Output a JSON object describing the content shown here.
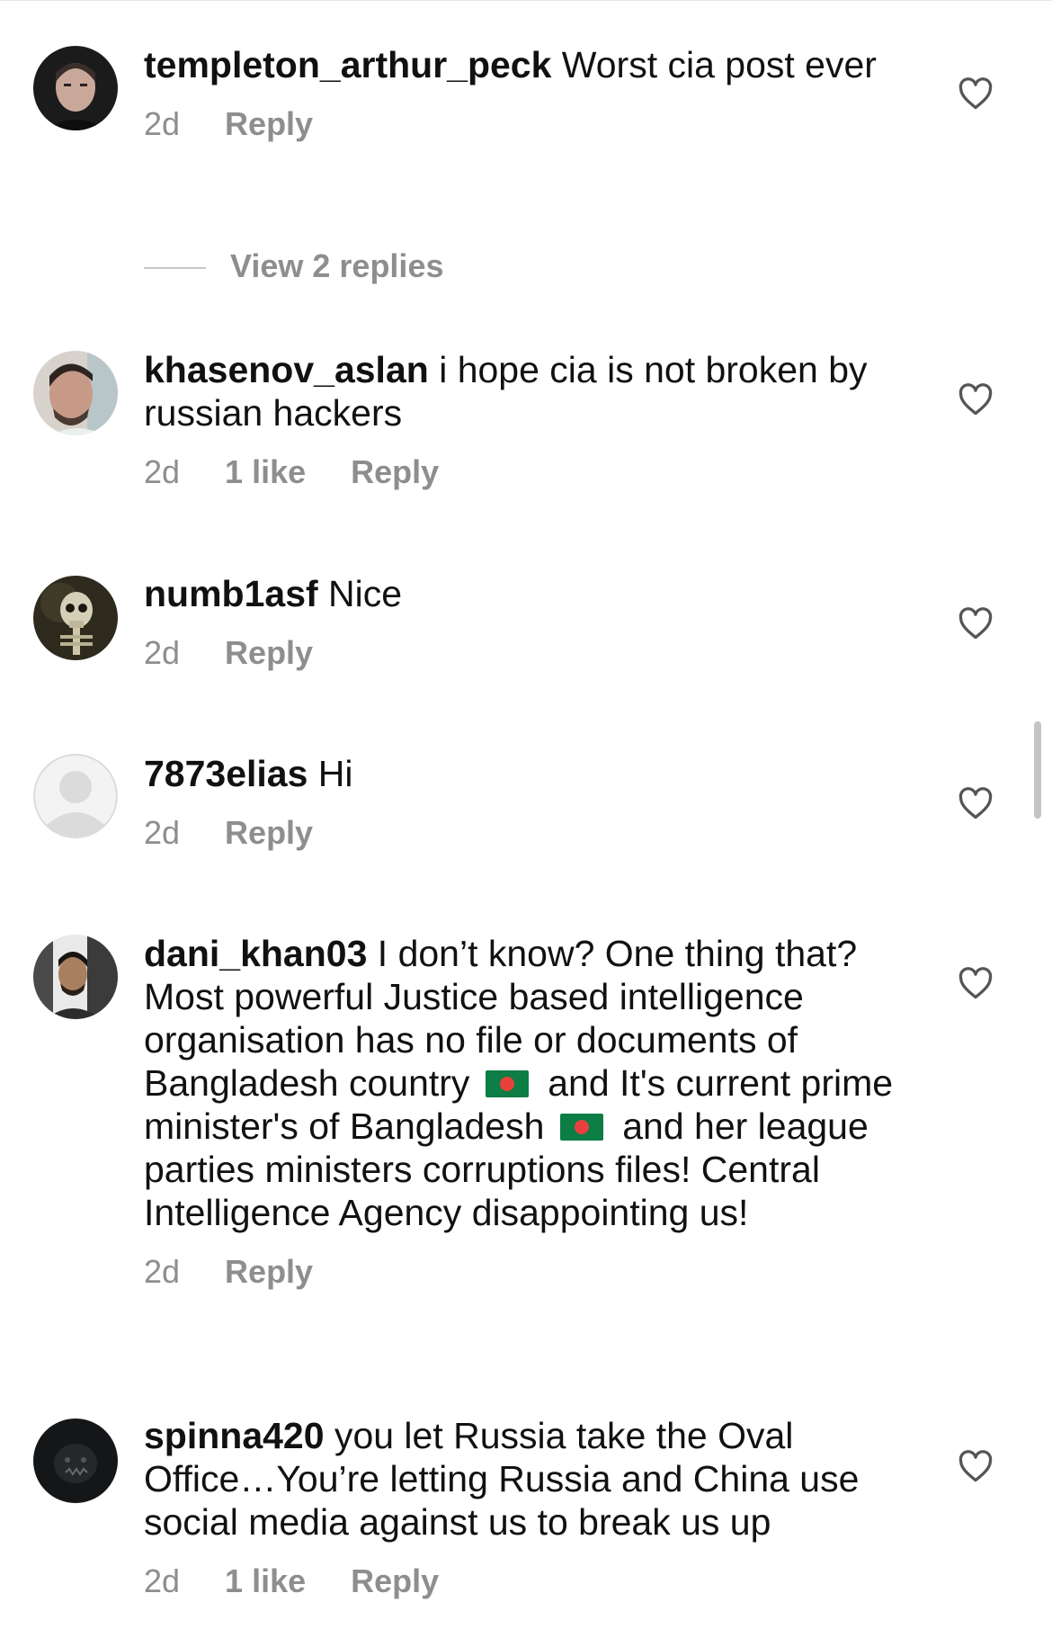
{
  "comments": [
    {
      "username": "templeton_arthur_peck",
      "text": " Worst cia post ever",
      "time": "2d",
      "likes": "",
      "reply_label": "Reply"
    },
    {
      "username": "khasenov_aslan",
      "text": " i hope cia is not broken by russian hackers",
      "time": "2d",
      "likes": "1 like",
      "reply_label": "Reply"
    },
    {
      "username": "numb1asf",
      "text": " Nice",
      "time": "2d",
      "likes": "",
      "reply_label": "Reply"
    },
    {
      "username": "7873elias",
      "text": " Hi",
      "time": "2d",
      "likes": "",
      "reply_label": "Reply"
    },
    {
      "username": "dani_khan03",
      "text_part1": " I don’t know? One thing that? Most powerful Justice based intelligence organisation has no file or documents of Bangladesh country",
      "text_part2": "and It's current prime minister's of Bangladesh",
      "text_part3": "and her league parties ministers corruptions files! Central Intelligence Agency disappointing us!",
      "flag_icon": "bangladesh-flag-icon",
      "time": "2d",
      "likes": "",
      "reply_label": "Reply"
    },
    {
      "username": "spinna420",
      "text": " you let Russia take the Oval Office…You’re letting Russia and China use social media against us to break us up",
      "time": "2d",
      "likes": "1 like",
      "reply_label": "Reply"
    }
  ],
  "view_replies_label": "View 2 replies",
  "icons": {
    "like": "heart-outline-icon",
    "avatar_default": "default-avatar-icon"
  },
  "colors": {
    "text": "#111111",
    "secondary": "#8e8e8e",
    "flag_green": "#0c7d44",
    "flag_red": "#e8413d"
  }
}
